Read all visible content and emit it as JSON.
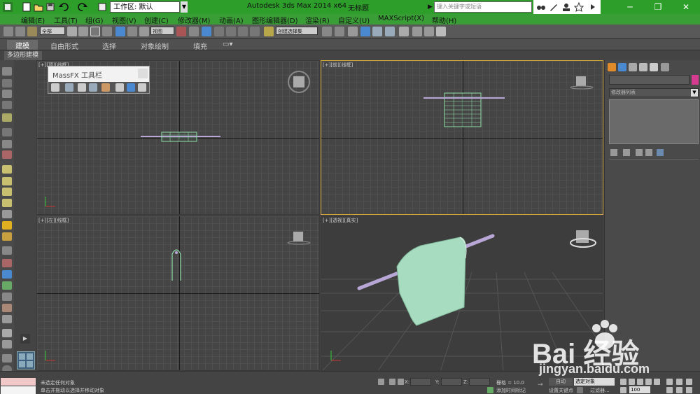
{
  "title_bar": {
    "workspace_value": "工作区: 默认",
    "app_name": "Autodesk 3ds Max  2014 x64",
    "doc_title": "无标题",
    "search_placeholder": "键入关键字或短语"
  },
  "menu": {
    "items": [
      "编辑(E)",
      "工具(T)",
      "组(G)",
      "视图(V)",
      "创建(C)",
      "修改器(M)",
      "动画(A)",
      "图形编辑器(D)",
      "渲染(R)",
      "自定义(U)",
      "MAXScript(X)",
      "帮助(H)"
    ]
  },
  "toolbar": {
    "selection_filter": "全部",
    "ref_coord": "视图",
    "named_selection": "创建选择集"
  },
  "ribbon": {
    "tabs": [
      "建模",
      "自由形式",
      "选择",
      "对象绘制",
      "填充"
    ],
    "sub_tab": "多边形建模"
  },
  "massfx": {
    "title": "MassFX 工具栏"
  },
  "viewports": {
    "top": "[+][顶][线框]",
    "front": "[+][前][线框]",
    "left": "[+][左][线框]",
    "perspective": "[+][透视][真实]"
  },
  "command_panel": {
    "modifier_list": "修改器列表",
    "object_color": "#d63b8f"
  },
  "status": {
    "line1": "未选定任何对象",
    "line2": "单击并拖动以选择并移动对象",
    "x_label": "X:",
    "y_label": "Y:",
    "z_label": "Z:",
    "grid": "栅格 = 10.0",
    "add_time_tag": "添加时间标记",
    "auto_key": "自动",
    "key_selection": "选定对象",
    "set_key": "设置关键点",
    "key_filters": "过滤器...",
    "frame": "100"
  },
  "watermark": {
    "brand": "Bai  经验",
    "url": "jingyan.baidu.com"
  },
  "colors": {
    "titlebar": "#2e9e2b",
    "cloth": "#a8dcc0",
    "pole": "#b7a6d6",
    "active_viewport_border": "#c9a53b"
  }
}
